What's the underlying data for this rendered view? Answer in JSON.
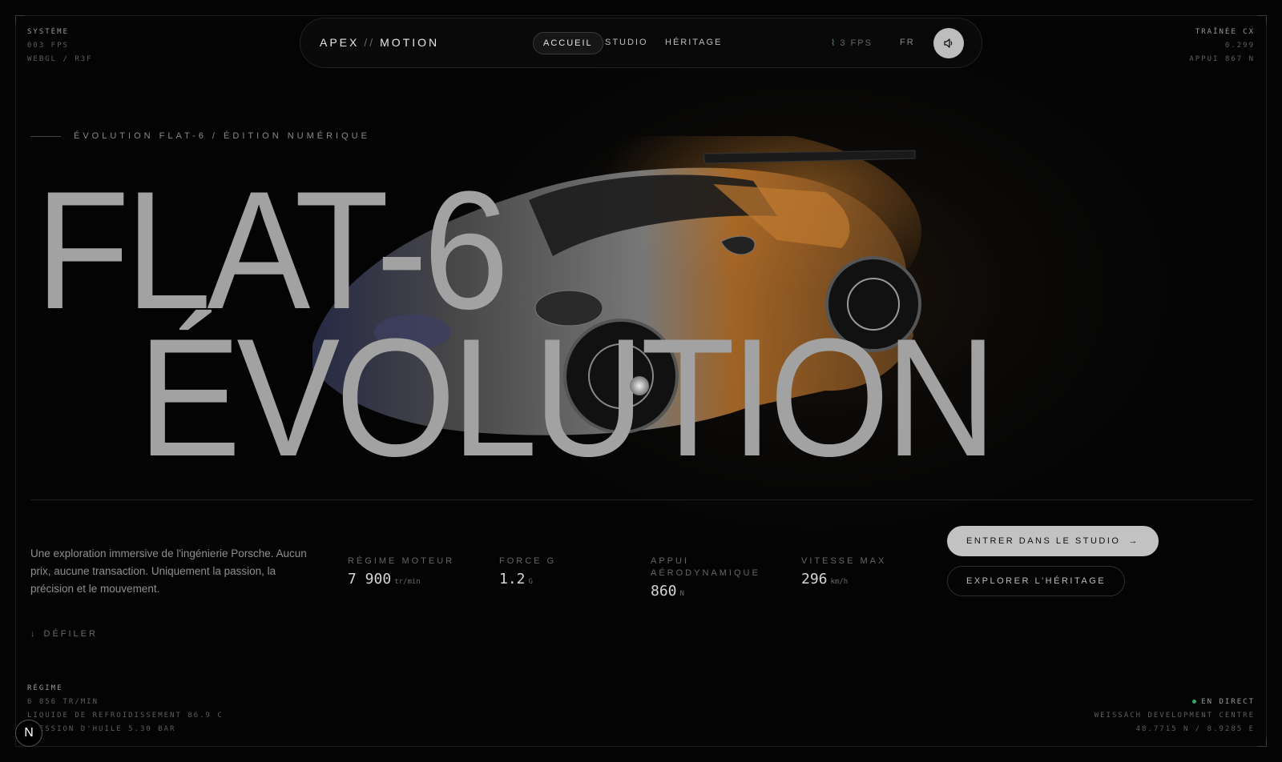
{
  "hud": {
    "top_left": {
      "title": "SYSTÈME",
      "line1": "003 FPS",
      "line2": "WEBGL / R3F"
    },
    "top_right": {
      "title": "TRAÎNÉE CX",
      "line1": "0.299",
      "line2": "APPUI 867 N"
    },
    "bottom_left": {
      "title": "RÉGIME",
      "line1": "6 856 TR/MIN",
      "line2": "LIQUIDE DE REFROIDISSEMENT 86.9 C",
      "line3": "PRESSION D'HUILE 5.30 BAR"
    },
    "bottom_right": {
      "live": "EN DIRECT",
      "line1": "WEISSACH DEVELOPMENT CENTRE",
      "line2": "48.7715 N / 8.9285 E"
    }
  },
  "nav": {
    "brand_left": "APEX",
    "brand_sep": "//",
    "brand_right": "MOTION",
    "links": [
      "ACCUEIL",
      "STUDIO",
      "HÉRITAGE"
    ],
    "fps": "3 FPS",
    "lang": "FR",
    "sound_icon": "speaker-icon"
  },
  "hero": {
    "eyebrow": "ÉVOLUTION FLAT-6 / ÉDITION NUMÉRIQUE",
    "title_line1": "FLAT-6",
    "title_line2": "ÉVOLUTION",
    "intro": "Une exploration immersive de l'ingénierie Porsche. Aucun prix, aucune transaction. Uniquement la passion, la précision et le mouvement."
  },
  "stats": [
    {
      "label": "RÉGIME MOTEUR",
      "value": "7 900",
      "unit": "tr/min"
    },
    {
      "label": "FORCE G",
      "value": "1.2",
      "unit": "G"
    },
    {
      "label": "APPUI AÉRODYNAMIQUE",
      "value": "860",
      "unit": "N"
    },
    {
      "label": "VITESSE MAX",
      "value": "296",
      "unit": "km/h"
    }
  ],
  "buttons": {
    "primary": "ENTRER DANS LE STUDIO",
    "secondary": "EXPLORER L'HÉRITAGE"
  },
  "scroll": "DÉFILER",
  "logo": "N",
  "colors": {
    "accent_green": "#3aa56a",
    "car_copper": "#b9722a",
    "text_grey": "#a2a2a2"
  }
}
